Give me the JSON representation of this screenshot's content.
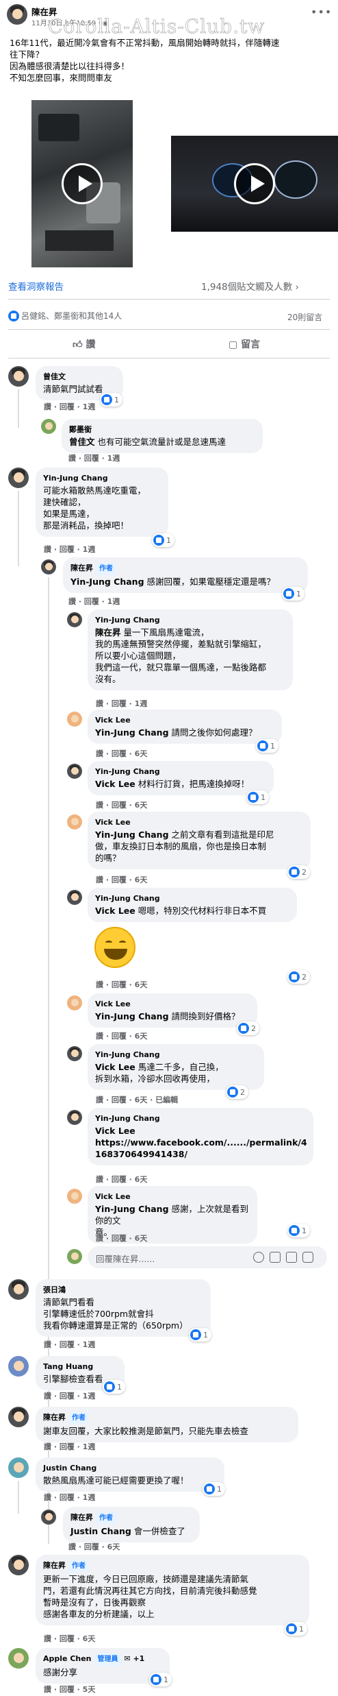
{
  "post": {
    "author": "陳在昇",
    "time": "11月30日上午10:59",
    "privacy_icon": "globe-icon",
    "watermark": "Corolla-Altis-Club.tw",
    "text_lines": [
      "16年11代，最近開冷氣會有不正常抖動，風扇開始轉時就抖，伴隨轉速",
      "往下降？",
      "因為體感很清楚比以往抖得多！",
      "不知怎麼回事，來問問車友"
    ],
    "insights_link": "查看洞察報告",
    "reach_text": "1,948個貼文觸及人數",
    "reactions_text": "呂健銘、鄭墨銜和其他14人",
    "comment_count": "20則留言",
    "like_label": "讚",
    "comment_label": "留言"
  },
  "comments": [
    {
      "name": "曾佳文",
      "text": [
        "清節氣門試試看"
      ],
      "meta": "讚 · 回覆 · 1週",
      "react": "1"
    },
    {
      "name": "鄭墨銜",
      "tag": "曾佳文",
      "text": [
        "也有可能空氣流量計或是怠速馬達"
      ],
      "meta": "讚 · 回覆 · 1週"
    },
    {
      "name": "Yin-Jung Chang",
      "text": [
        "可能水箱散熱馬達吃重電，",
        "建快確認，",
        "如果是馬達，",
        "那是消耗品，換掉吧！"
      ],
      "meta": "讚 · 回覆 · 1週",
      "react": "1"
    },
    {
      "name": "陳在昇",
      "author": "作者",
      "tag": "Yin-Jung Chang",
      "text": [
        "感謝回覆，如果電壓穩定還是嗎？"
      ],
      "meta": "讚 · 回覆 · 1週",
      "react": "1"
    },
    {
      "name": "Yin-Jung Chang",
      "tag": "陳在昇",
      "text": [
        "量一下風扇馬達電流，",
        "我的馬達無預警突然停擺，差點就引擎縮缸，",
        "所以要小心這個問題，",
        "我們這一代，就只靠單一個馬達，一點後路都",
        "沒有。"
      ],
      "meta": "讚 · 回覆 · 1週"
    },
    {
      "name": "Vick Lee",
      "tag": "Yin-Jung Chang",
      "text": [
        "請問之後你如何處理？"
      ],
      "meta": "讚 · 回覆 · 6天",
      "react": "1"
    },
    {
      "name": "Yin-Jung Chang",
      "tag": "Vick Lee",
      "text": [
        "材料行訂貨，把馬達換掉呀！"
      ],
      "meta": "讚 · 回覆 · 6天",
      "react": "1"
    },
    {
      "name": "Vick Lee",
      "tag": "Yin-Jung Chang",
      "text": [
        "之前文章有看到這批是印尼",
        "做，車友換訂日本制的風扇，你也是換日本制",
        "的嗎？"
      ],
      "meta": "讚 · 回覆 · 6天",
      "react": "2"
    },
    {
      "name": "Yin-Jung Chang",
      "tag": "Vick Lee",
      "text": [
        "嗯嗯，特別交代材料行非日本不買"
      ],
      "meta": "讚 · 回覆 · 6天",
      "react": "2"
    },
    {
      "name": "Vick Lee",
      "tag": "Yin-Jung Chang",
      "text": [
        "請問換到好價格？"
      ],
      "meta": "讚 · 回覆 · 6天",
      "react": "2"
    },
    {
      "name": "Yin-Jung Chang",
      "tag": "Vick Lee",
      "text": [
        "馬達二千多，自己換，",
        "拆到水箱，冷卻水回收再使用，"
      ],
      "meta": "讚 · 回覆 · 6天 · 已編輯",
      "react": "2"
    },
    {
      "name": "Yin-Jung Chang",
      "tag": "Vick Lee",
      "text": [
        "https://www.facebook.com/....../permalink/4",
        "168370649941438/"
      ],
      "meta": "讚 · 回覆 · 6天"
    },
    {
      "name": "Vick Lee",
      "tag": "Yin-Jung Chang",
      "text": [
        "感謝，上次就是看到你的文",
        "章。"
      ],
      "meta": "讚 · 回覆 · 6天",
      "react": "1"
    },
    {
      "name": "張日鴻",
      "text": [
        "清節氣門看看",
        "引擎轉速低於700rpm就會抖",
        "我看你轉速還算是正常的（650rpm）"
      ],
      "meta": "讚 · 回覆 · 1週",
      "react": "1"
    },
    {
      "name": "Tang Huang",
      "text": [
        "引擎腳檢查看看"
      ],
      "meta": "讚 · 回覆 · 1週",
      "react": "1"
    },
    {
      "name": "陳在昇",
      "author": "作者",
      "text": [
        "謝車友回覆，大家比較推測是節氣門，只能先車去檢查"
      ],
      "meta": "讚 · 回覆 · 1週"
    },
    {
      "name": "Justin Chang",
      "text": [
        "散熱風扇馬達可能已經需要更換了喔！"
      ],
      "meta": "讚 · 回覆 · 1週",
      "react": "1"
    },
    {
      "name": "陳在昇",
      "author": "作者",
      "tag": "Justin Chang",
      "text": [
        "會一併檢查了"
      ],
      "meta": "讚 · 回覆 · 6天"
    },
    {
      "name": "陳在昇",
      "author": "作者",
      "text": [
        "更新一下進度，今日已回原廠，技師還是建議先清節氣",
        "門，若還有此情況再往其它方向找，目前清完後抖動感覺",
        "暫時是沒有了，日後再觀察",
        "感謝各車友的分析建議，以上"
      ],
      "meta": "讚 · 回覆 · 6天",
      "react": "1"
    },
    {
      "name": "Apple Chen",
      "badge": "管理員",
      "plus": "+1",
      "text": [
        "感謝分享"
      ],
      "meta": "讚 · 回覆 · 5天",
      "react": "1"
    }
  ],
  "reply_placeholder": "回覆陳在昇......"
}
